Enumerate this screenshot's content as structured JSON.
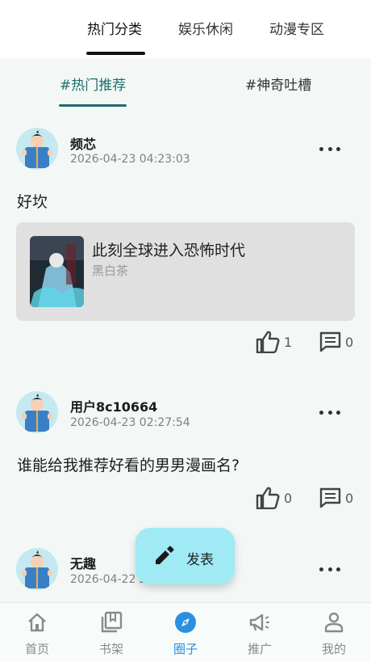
{
  "top_tabs": [
    {
      "label": "热门分类",
      "active": true
    },
    {
      "label": "娱乐休闲",
      "active": false
    },
    {
      "label": "动漫专区",
      "active": false
    }
  ],
  "sub_tabs": [
    {
      "label": "#热门推荐",
      "active": true
    },
    {
      "label": "#神奇吐槽",
      "active": false
    }
  ],
  "posts": [
    {
      "author": "频芯",
      "time": "2026-04-23 04:23:03",
      "content": "好坎",
      "book": {
        "title": "此刻全球进入恐怖时代",
        "author": "黑白茶"
      },
      "likes": "1",
      "comments": "0"
    },
    {
      "author": "用户8c10664",
      "time": "2026-04-23 02:27:54",
      "content": "谁能给我推荐好看的男男漫画名?",
      "likes": "0",
      "comments": "0"
    },
    {
      "author": "无趣",
      "time": "2026-04-22 2"
    }
  ],
  "fab": {
    "label": "发表",
    "icon": "pencil-icon"
  },
  "bottom_nav": [
    {
      "label": "首页",
      "icon": "home-icon",
      "active": false
    },
    {
      "label": "书架",
      "icon": "bookshelf-icon",
      "active": false
    },
    {
      "label": "圈子",
      "icon": "compass-icon",
      "active": true
    },
    {
      "label": "推广",
      "icon": "megaphone-icon",
      "active": false
    },
    {
      "label": "我的",
      "icon": "person-icon",
      "active": false
    }
  ],
  "colors": {
    "accent_teal": "#1f6d6d",
    "nav_active": "#2b8fe0",
    "fab": "#9feaf5",
    "background": "#f3f8f7"
  }
}
